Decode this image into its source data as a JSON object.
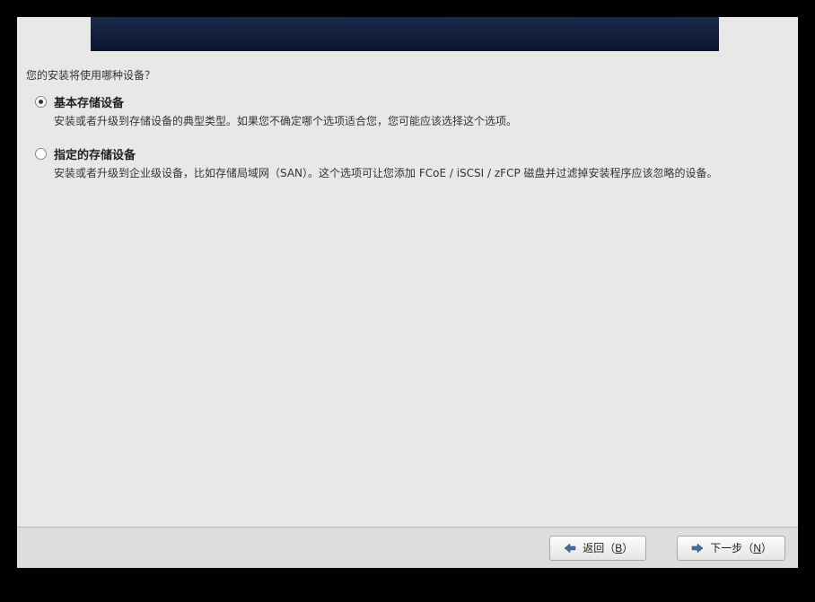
{
  "prompt": "您的安装将使用哪种设备？",
  "options": {
    "basic": {
      "title": "基本存储设备",
      "description": "安装或者升级到存储设备的典型类型。如果您不确定哪个选项适合您，您可能应该选择这个选项。"
    },
    "specialized": {
      "title": "指定的存储设备",
      "description": "安装或者升级到企业级设备，比如存储局域网（SAN）。这个选项可让您添加 FCoE / iSCSI / zFCP 磁盘并过滤掉安装程序应该忽略的设备。"
    }
  },
  "buttons": {
    "back_prefix": "返回（",
    "back_key": "B",
    "back_suffix": "）",
    "next_prefix": "下一步（",
    "next_key": "N",
    "next_suffix": "）"
  }
}
